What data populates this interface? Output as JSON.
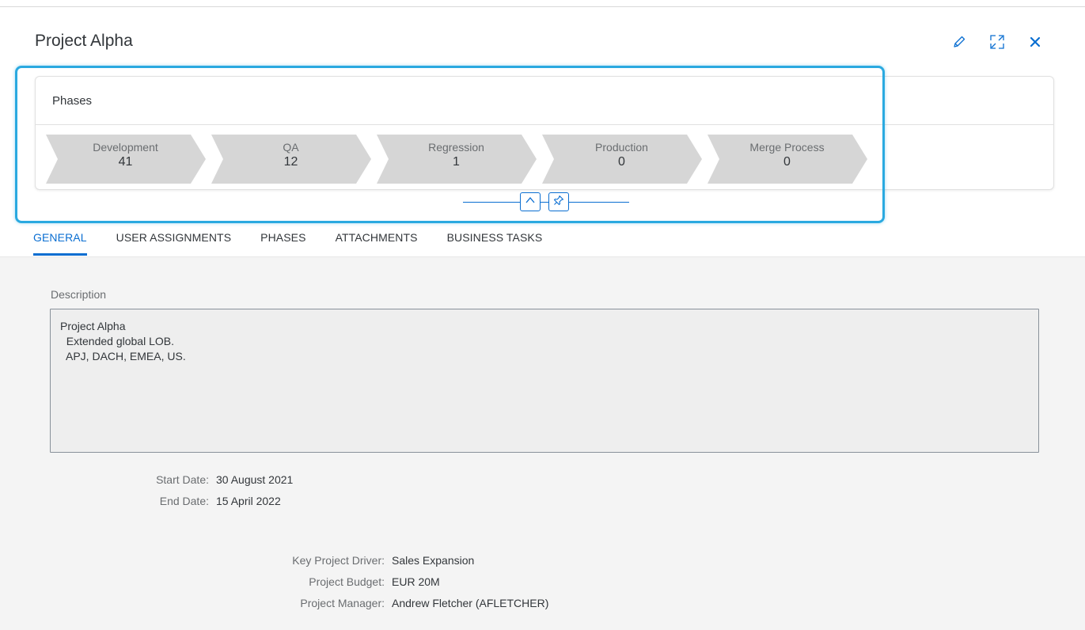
{
  "header": {
    "title": "Project Alpha",
    "actions": [
      {
        "icon": "edit-icon"
      },
      {
        "icon": "fullscreen-icon"
      },
      {
        "icon": "close-icon"
      }
    ]
  },
  "phases_card": {
    "title": "Phases",
    "phases": [
      {
        "label": "Development",
        "count": "41"
      },
      {
        "label": "QA",
        "count": "12"
      },
      {
        "label": "Regression",
        "count": "1"
      },
      {
        "label": "Production",
        "count": "0"
      },
      {
        "label": "Merge Process",
        "count": "0"
      }
    ],
    "collapse_icons": [
      "collapse-up-icon",
      "pin-icon"
    ]
  },
  "tabs": [
    {
      "label": "GENERAL",
      "selected": true
    },
    {
      "label": "USER ASSIGNMENTS",
      "selected": false
    },
    {
      "label": "PHASES",
      "selected": false
    },
    {
      "label": "ATTACHMENTS",
      "selected": false
    },
    {
      "label": "BUSINESS TASKS",
      "selected": false
    }
  ],
  "general": {
    "description_label": "Description",
    "description_value": "Project Alpha\n  Extended global LOB.\n  APJ, DACH, EMEA, US.",
    "dates": [
      {
        "label": "Start Date:",
        "value": "30 August 2021"
      },
      {
        "label": "End Date:",
        "value": "15 April 2022"
      }
    ],
    "details": [
      {
        "label": "Key Project Driver:",
        "value": "Sales Expansion"
      },
      {
        "label": "Project Budget:",
        "value": "EUR 20M"
      },
      {
        "label": "Project Manager:",
        "value": "Andrew Fletcher (AFLETCHER)"
      }
    ]
  },
  "colors": {
    "accent": "#0a6ed1",
    "focus_highlight": "#2aa9e0",
    "chevron_fill": "#d6d6d6",
    "content_background": "#f4f4f4"
  }
}
